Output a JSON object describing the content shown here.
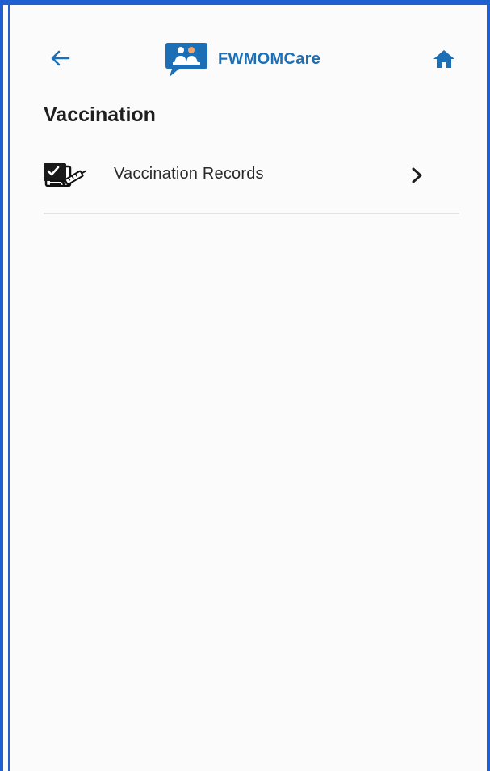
{
  "header": {
    "back_icon": "arrow-left-icon",
    "app_name": "FWMOMCare",
    "logo_icon": "chat-bubble-family-icon",
    "home_icon": "home-icon"
  },
  "page": {
    "title": "Vaccination"
  },
  "menu": {
    "items": [
      {
        "label": "Vaccination Records",
        "icon": "vaccine-record-icon",
        "trailing_icon": "chevron-right-icon"
      }
    ]
  },
  "colors": {
    "frame_border": "#1f5fd0",
    "brand": "#1d6fb5",
    "background": "#fbfbfc",
    "divider": "#e3e3e5"
  }
}
